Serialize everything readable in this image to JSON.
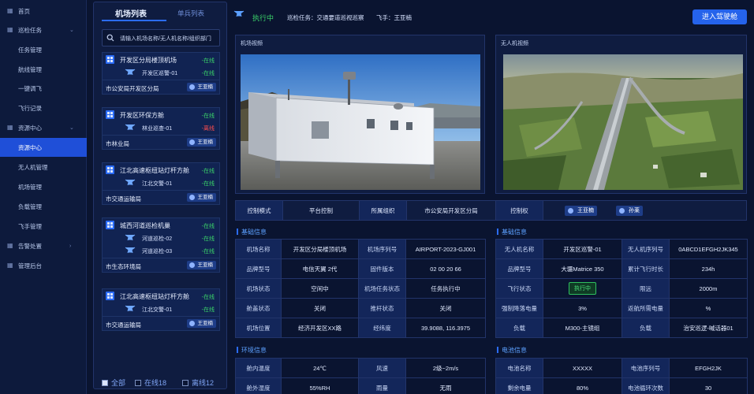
{
  "nav": {
    "items": [
      {
        "label": "首页",
        "icon": "home-icon",
        "type": "top"
      },
      {
        "label": "巡检任务",
        "icon": "task-icon",
        "type": "group",
        "chevron": "⌄"
      },
      {
        "label": "任务管理",
        "type": "sub"
      },
      {
        "label": "航线管理",
        "type": "sub"
      },
      {
        "label": "一键调飞",
        "type": "sub"
      },
      {
        "label": "飞行记录",
        "type": "sub"
      },
      {
        "label": "资源中心",
        "icon": "resource-icon",
        "type": "group",
        "chevron": "⌄"
      },
      {
        "label": "资源中心",
        "type": "sub",
        "active": true
      },
      {
        "label": "无人机管理",
        "type": "sub"
      },
      {
        "label": "机场管理",
        "type": "sub"
      },
      {
        "label": "负载管理",
        "type": "sub"
      },
      {
        "label": "飞手管理",
        "type": "sub"
      },
      {
        "label": "告警处置",
        "icon": "alarm-icon",
        "type": "group",
        "chevron": "›"
      },
      {
        "label": "管理后台",
        "icon": "admin-icon",
        "type": "group"
      }
    ]
  },
  "list": {
    "tabs": [
      "机场列表",
      "单兵列表"
    ],
    "search_placeholder": "请输入机场名称/无人机名称/组织部门",
    "cards": [
      {
        "name": "开发区分局楼顶机场",
        "status": "-在线",
        "uavs": [
          {
            "name": "开发区巡警-01",
            "status": "-在线"
          }
        ],
        "org": "市公安局开发区分局",
        "pilot": "王亚楠"
      },
      {
        "name": "开发区环保方舱",
        "status": "-在线",
        "uavs": [
          {
            "name": "林业巡查-01",
            "status": "-离线",
            "offline": true
          }
        ],
        "org": "市林业局",
        "pilot": "王亚楠"
      },
      {
        "name": "江北高速枢纽站灯杆方舱",
        "status": "-在线",
        "uavs": [
          {
            "name": "江北交警-01",
            "status": "-在线"
          }
        ],
        "org": "市交通运输局",
        "pilot": "王亚楠"
      },
      {
        "name": "城西河道巡检机巢",
        "status": "-在线",
        "uavs": [
          {
            "name": "河道巡检-02",
            "status": "-在线"
          },
          {
            "name": "河道巡检-03",
            "status": "-在线"
          }
        ],
        "org": "市生态环境局",
        "pilot": "王亚楠"
      },
      {
        "name": "江北高速枢纽站灯杆方舱",
        "status": "-在线",
        "uavs": [
          {
            "name": "江北交警-01",
            "status": "-在线"
          }
        ],
        "org": "市交通运输局",
        "pilot": "王亚楠"
      }
    ],
    "filters": [
      {
        "label": "全部",
        "checked": true
      },
      {
        "label": "在线18",
        "checked": false
      },
      {
        "label": "离线12",
        "checked": false
      }
    ]
  },
  "header": {
    "status": "执行中",
    "task": "巡检任务：交通要道巡视巡察",
    "pilot": "飞手：王亚楠",
    "enter_button": "进入驾驶舱"
  },
  "videos": {
    "airport_title": "机场视频",
    "drone_title": "无人机视频"
  },
  "infobar": {
    "control_mode_label": "控制模式",
    "control_mode": "平台控制",
    "org_label": "所属组织",
    "org": "市公安局开发区分局",
    "control_right_label": "控制权",
    "pilots": [
      "王亚楠",
      "孙莱"
    ]
  },
  "airport_info": {
    "title": "基础信息",
    "rows": [
      [
        "机场名称",
        "开发区分局楼顶机场",
        "机场序列号",
        "AIRPORT-2023-GJ001"
      ],
      [
        "品牌型号",
        "电信天翼 2代",
        "固件版本",
        "02 00 20 66"
      ],
      [
        "机场状态",
        "空闲中",
        "机场任务状态",
        "任务执行中"
      ],
      [
        "舱盖状态",
        "关闭",
        "推杆状态",
        "关闭"
      ],
      [
        "机场位置",
        "经济开发区XX路",
        "经纬度",
        "39.9088, 116.3975"
      ]
    ]
  },
  "uav_info": {
    "title": "基础信息",
    "rows": [
      [
        "无人机名称",
        "开发区巡警-01",
        "无人机序列号",
        "0ABCD1EFGH2JK345"
      ],
      [
        "品牌型号",
        "大疆Matrice 350",
        "累计飞行时长",
        "234h"
      ],
      [
        "飞行状态",
        "执行中",
        "限远",
        "2000m"
      ],
      [
        "强制降落电量",
        "3%",
        "返航所需电量",
        "%"
      ],
      [
        "负载",
        "M300-主镜组",
        "负载",
        "治安巡逻-喊话器01"
      ]
    ]
  },
  "env_info": {
    "title": "环境信息",
    "rows": [
      [
        "舱内温度",
        "24℃",
        "风速",
        "2级~2m/s"
      ],
      [
        "舱外湿度",
        "55%RH",
        "雨量",
        "无雨"
      ]
    ]
  },
  "battery_info": {
    "title": "电池信息",
    "rows": [
      [
        "电池名称",
        "XXXXX",
        "电池序列号",
        "EFGH2JK"
      ],
      [
        "剩余电量",
        "80%",
        "电池循环次数",
        "30"
      ]
    ]
  },
  "colors": {
    "online": "#3bd46a",
    "offline": "#ff4d4d",
    "accent": "#2563eb"
  }
}
